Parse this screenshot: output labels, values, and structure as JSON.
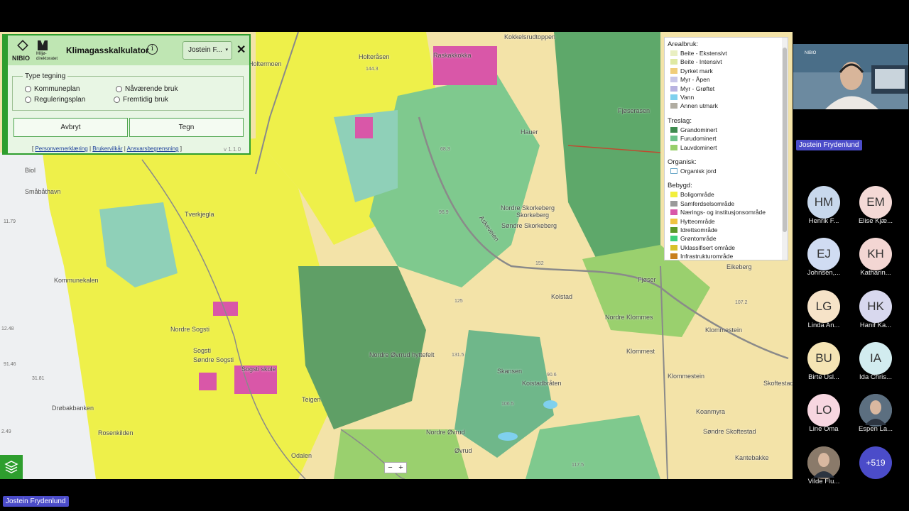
{
  "panel": {
    "logo1": "NIBIO",
    "logo2": "Miljø-\ndirektoratet",
    "title": "Klimagasskalkulator",
    "info_glyph": "i",
    "user_select": "Jostein F...",
    "close_glyph": "✕",
    "type_legend": "Type tegning",
    "radios": [
      "Kommuneplan",
      "Reguleringsplan",
      "Nåværende bruk",
      "Fremtidig bruk"
    ],
    "cancel_label": "Avbryt",
    "draw_label": "Tegn",
    "links": [
      "Personvernerklæring",
      "Brukervilkår",
      "Ansvarsbegrensning"
    ],
    "version": "v 1.1.0"
  },
  "legend": {
    "sections": [
      {
        "heading": "Arealbruk:",
        "items": [
          {
            "label": "Beite - Ekstensivt",
            "color": "#e9efc1"
          },
          {
            "label": "Beite - Intensivt",
            "color": "#dfe9a3"
          },
          {
            "label": "Dyrket mark",
            "color": "#f0cd7a"
          },
          {
            "label": "Myr - Åpen",
            "color": "#c8c6e8"
          },
          {
            "label": "Myr - Grøftet",
            "color": "#b8b2e0"
          },
          {
            "label": "Vann",
            "color": "#7fd0ee"
          },
          {
            "label": "Annen utmark",
            "color": "#b1ada2"
          }
        ]
      },
      {
        "heading": "Treslag:",
        "items": [
          {
            "label": "Grandominert",
            "color": "#3e8b4f"
          },
          {
            "label": "Furudominert",
            "color": "#6cc28a"
          },
          {
            "label": "Lauvdominert",
            "color": "#97cf6b"
          }
        ]
      },
      {
        "heading": "Organisk:",
        "items": [
          {
            "label": "Organisk jord",
            "color": "#ffffff"
          }
        ]
      },
      {
        "heading": "Bebygd:",
        "items": [
          {
            "label": "Boligområde",
            "color": "#f2ef3c"
          },
          {
            "label": "Samferdselsområde",
            "color": "#9a9a9a"
          },
          {
            "label": "Nærings- og institusjonsområde",
            "color": "#d957a8"
          },
          {
            "label": "Hytteområde",
            "color": "#f0c341"
          },
          {
            "label": "Idrettsområde",
            "color": "#5a9a2a"
          },
          {
            "label": "Grøntområde",
            "color": "#3ed07a"
          },
          {
            "label": "Uklassifisert område",
            "color": "#d8c22a"
          },
          {
            "label": "Infrastrukturområde",
            "color": "#c8801e"
          }
        ]
      }
    ]
  },
  "map_labels": [
    "Hauer",
    "Nordre Skorkeberg",
    "Skorkeberg",
    "Søndre Skorkeberg",
    "Tverkjegla",
    "Kommunekalen",
    "Småbåthavn",
    "Biol",
    "Drøbakbanken",
    "Nordre Sogsti",
    "Sogsti",
    "Søndre Sogsti",
    "Sogsti skole",
    "Nordre Øvrrud hyttefelt",
    "Skansen",
    "Koistadbråten",
    "Kolstad",
    "Nordre Klommes",
    "Klommestein",
    "Klommest",
    "Skoftestad",
    "Klommestein",
    "Koanmyra",
    "Søndre Skoftestad",
    "Kantebakke",
    "Fjøser",
    "Eikeberg",
    "Nordre Øvrud",
    "Øvrud",
    "Odalen",
    "Teigen",
    "Rosenkilden",
    "Askeveien",
    "Fjøserasen",
    "Kokkelsrudtoppen",
    "Raskakkokka",
    "Holteråsen",
    "Holtermoen"
  ],
  "map_numbers": [
    "152",
    "125",
    "131.5",
    "90.6",
    "106.5",
    "96.9",
    "68.3",
    "144.3",
    "117.5",
    "107.2",
    "11.79",
    "12.48",
    "91.46",
    "31.81",
    "2.49"
  ],
  "zoom": {
    "minus": "−",
    "plus": "+"
  },
  "participants": {
    "presenter": "Jostein Frydenlund",
    "tile_logo": "NIBIO",
    "avatars": [
      {
        "initials": "HM",
        "name": "Henrik F...",
        "color": "#c8d8ec"
      },
      {
        "initials": "EM",
        "name": "Elise Kjæ...",
        "color": "#f4d9d6"
      },
      {
        "initials": "EJ",
        "name": "Johnsen,...",
        "color": "#d0dcf2"
      },
      {
        "initials": "KH",
        "name": "Katharin...",
        "color": "#f3d6d3"
      },
      {
        "initials": "LG",
        "name": "Linda An...",
        "color": "#f6e3c8"
      },
      {
        "initials": "HK",
        "name": "Hanif Ka...",
        "color": "#d8d8ee"
      },
      {
        "initials": "BU",
        "name": "Birte Usl...",
        "color": "#f5e4b4"
      },
      {
        "initials": "IA",
        "name": "Ida Chris...",
        "color": "#d2ecef"
      },
      {
        "initials": "LO",
        "name": "Line Oma",
        "color": "#f7d6e0"
      },
      {
        "initials": "",
        "name": "Espen La...",
        "color": "#5c6f80"
      },
      {
        "initials": "",
        "name": "Vilde Flu...",
        "color": "#8a7a6a"
      },
      {
        "initials": "+519",
        "name": "",
        "color": "#4b4cc9"
      }
    ]
  },
  "bottom_name_tag": "Jostein Frydenlund"
}
